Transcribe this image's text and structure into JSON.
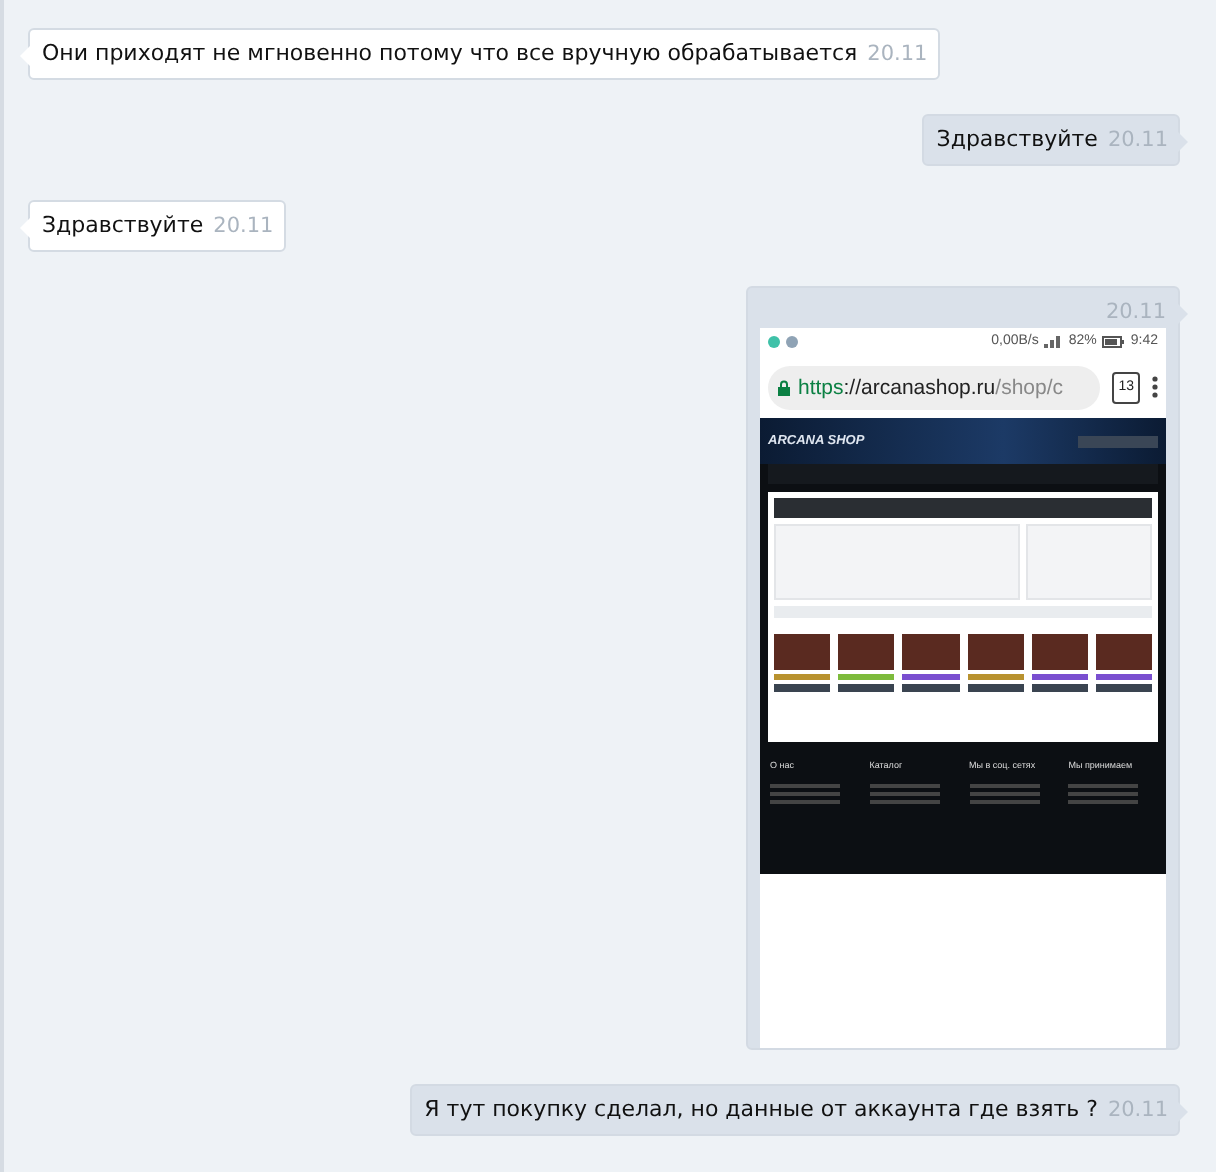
{
  "messages": [
    {
      "kind": "text",
      "outgoing": false,
      "text": "Они приходят не мгновенно потому что все вручную обрабатывается",
      "time": "20.11"
    },
    {
      "kind": "text",
      "outgoing": true,
      "text": "Здравствуйте",
      "time": "20.11"
    },
    {
      "kind": "text",
      "outgoing": false,
      "text": "Здравствуйте",
      "time": "20.11"
    },
    {
      "kind": "image",
      "outgoing": true,
      "time": "20.11",
      "screenshot": {
        "speed": "0,00B/s",
        "battery": "82%",
        "clock": "9:42",
        "url_parts": [
          "https",
          "://arcanashop.ru",
          "/shop/c"
        ],
        "tab_count": "13",
        "site_logo": "ARCANA SHOP",
        "footer_headings": [
          "О нас",
          "Каталог",
          "Мы в соц. сетях",
          "Мы принимаем"
        ]
      }
    },
    {
      "kind": "text",
      "outgoing": true,
      "text": "Я тут покупку сделал, но данные от аккаунта где взять ?",
      "time": "20.11"
    }
  ]
}
